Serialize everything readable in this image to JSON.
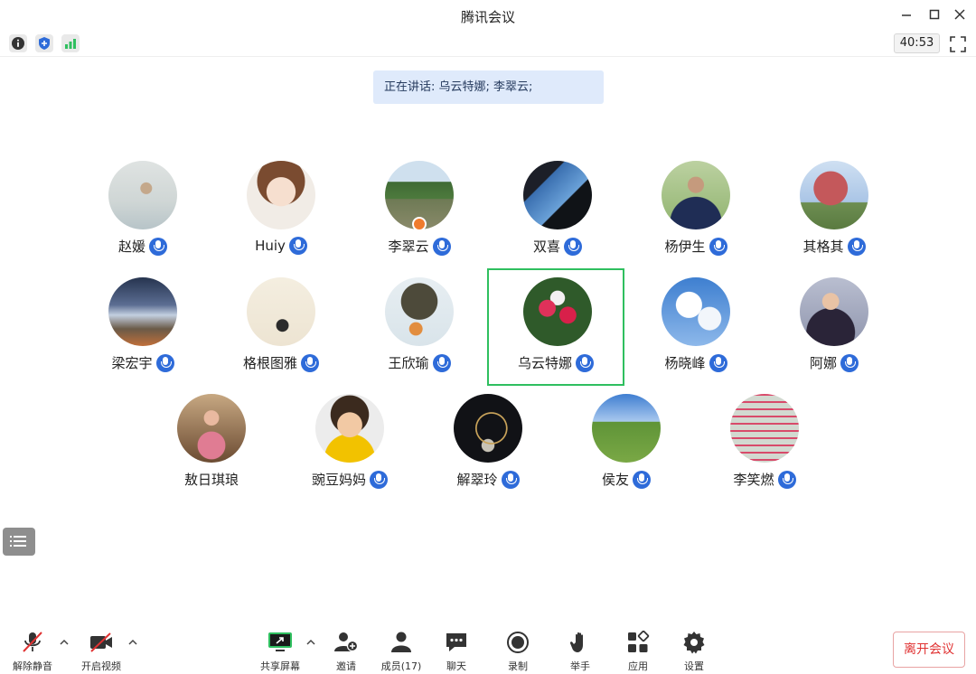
{
  "window": {
    "title": "腾讯会议"
  },
  "infobar": {
    "timer": "40:53"
  },
  "speaking": {
    "text": "正在讲话: 乌云特娜; 李翠云;"
  },
  "participants": [
    {
      "name": "赵媛",
      "mic": "mic-on"
    },
    {
      "name": "Huiy",
      "mic": "mic-on"
    },
    {
      "name": "李翠云",
      "mic": "mic-on",
      "host": true
    },
    {
      "name": "双喜",
      "mic": "mic-on"
    },
    {
      "name": "杨伊生",
      "mic": "mic-on"
    },
    {
      "name": "其格其",
      "mic": "mic-on"
    },
    {
      "name": "梁宏宇",
      "mic": "mic-on"
    },
    {
      "name": "格根图雅",
      "mic": "mic-on"
    },
    {
      "name": "王欣瑜",
      "mic": "mic-on"
    },
    {
      "name": "乌云特娜",
      "mic": "mic-on",
      "speaking": true
    },
    {
      "name": "杨晓峰",
      "mic": "mic-on"
    },
    {
      "name": "阿娜",
      "mic": "mic-on"
    },
    {
      "name": "敖日琪琅",
      "mic": "none"
    },
    {
      "name": "豌豆妈妈",
      "mic": "mic-on"
    },
    {
      "name": "解翠玲",
      "mic": "mic-on"
    },
    {
      "name": "侯友",
      "mic": "mic-on"
    },
    {
      "name": "李笑燃",
      "mic": "mic-on"
    }
  ],
  "toolbar": {
    "unmute": "解除静音",
    "start_video": "开启视频",
    "share_screen": "共享屏幕",
    "invite": "邀请",
    "members": "成员(17)",
    "chat": "聊天",
    "record": "录制",
    "raise_hand": "举手",
    "apps": "应用",
    "settings": "设置",
    "leave": "离开会议"
  },
  "colors": {
    "accent": "#2e6bd9",
    "active_border": "#2fbf5f",
    "leave": "#e03232",
    "speaking_bg": "#dfeafb"
  }
}
